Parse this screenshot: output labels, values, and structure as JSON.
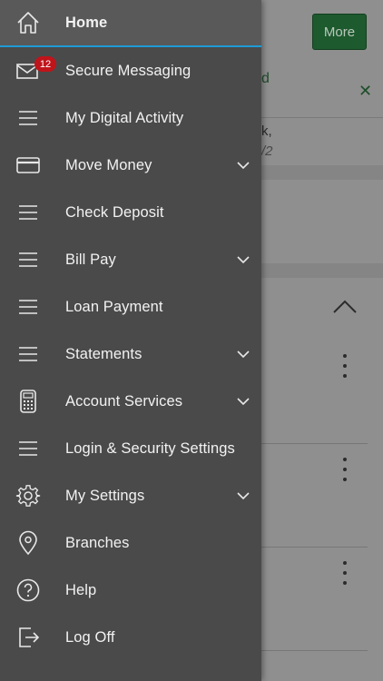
{
  "background": {
    "more_button": "More",
    "notice_fragment": "d",
    "text_line1": "k,",
    "text_line2": "/2"
  },
  "menu": {
    "badge_count": "12",
    "items": [
      {
        "label": "Home",
        "icon": "home-icon",
        "active": true
      },
      {
        "label": "Secure Messaging",
        "icon": "envelope-icon"
      },
      {
        "label": "My Digital Activity",
        "icon": "hamburger-icon"
      },
      {
        "label": "Move Money",
        "icon": "card-icon",
        "expandable": true
      },
      {
        "label": "Check Deposit",
        "icon": "hamburger-icon"
      },
      {
        "label": "Bill Pay",
        "icon": "hamburger-icon",
        "expandable": true
      },
      {
        "label": "Loan Payment",
        "icon": "hamburger-icon"
      },
      {
        "label": "Statements",
        "icon": "hamburger-icon",
        "expandable": true
      },
      {
        "label": "Account Services",
        "icon": "calculator-icon",
        "expandable": true
      },
      {
        "label": "Login & Security Settings",
        "icon": "hamburger-icon"
      },
      {
        "label": "My Settings",
        "icon": "gear-icon",
        "expandable": true
      },
      {
        "label": "Branches",
        "icon": "location-pin-icon"
      },
      {
        "label": "Help",
        "icon": "help-icon"
      },
      {
        "label": "Log Off",
        "icon": "logout-icon"
      }
    ]
  },
  "colors": {
    "drawer_bg": "#4a4a4a",
    "active_bg": "#595959",
    "accent_line": "#1e9bd7",
    "badge": "#c0141b",
    "more_button": "#1d5a2e"
  }
}
